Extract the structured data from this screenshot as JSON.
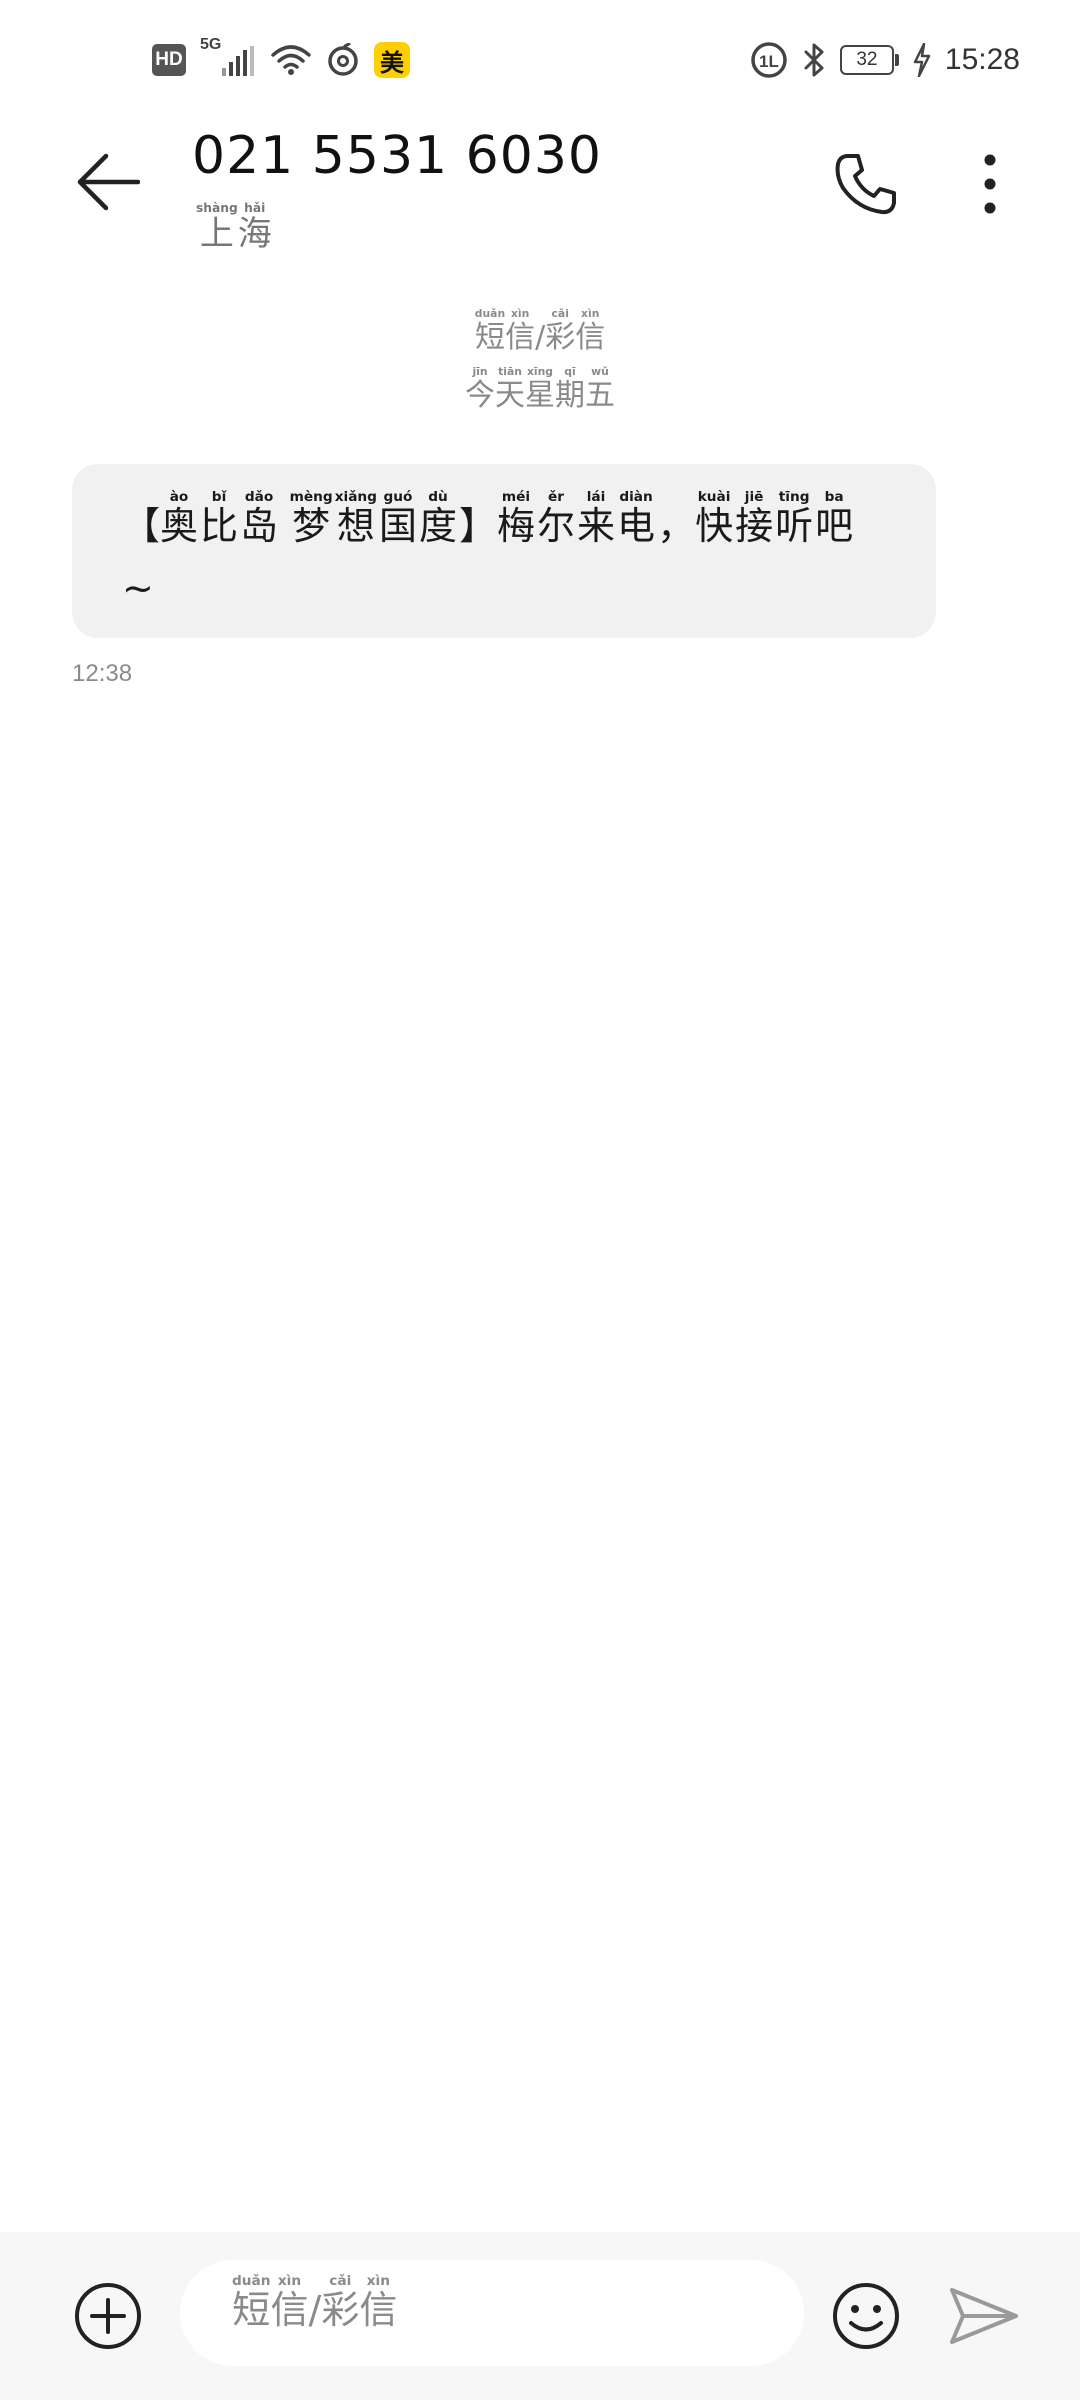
{
  "status_bar": {
    "hd_label": "HD",
    "network_label": "5G",
    "meituan_badge": "美",
    "battery_level": "32",
    "time": "15:28",
    "icons": [
      "hd-icon",
      "signal-icon",
      "wifi-icon",
      "netease-music-icon",
      "meituan-icon",
      "volte-icon",
      "bluetooth-icon",
      "battery-icon",
      "charging-icon"
    ]
  },
  "header": {
    "phone_number": "021 5531 6030",
    "location": [
      {
        "char": "上",
        "py": "shàng"
      },
      {
        "char": "海",
        "py": "hǎi"
      }
    ],
    "icons": [
      "back-arrow-icon",
      "phone-icon",
      "more-vertical-icon"
    ]
  },
  "conversation": {
    "type_label": [
      {
        "char": "短",
        "py": "duǎn"
      },
      {
        "char": "信",
        "py": "xìn"
      },
      {
        "char": "/",
        "py": ""
      },
      {
        "char": "彩",
        "py": "cǎi"
      },
      {
        "char": "信",
        "py": "xìn"
      }
    ],
    "date_label": [
      {
        "char": "今",
        "py": "jīn"
      },
      {
        "char": "天",
        "py": "tiān"
      },
      {
        "char": "星",
        "py": "xīng"
      },
      {
        "char": "期",
        "py": "qī"
      },
      {
        "char": "五",
        "py": "wǔ"
      }
    ]
  },
  "messages": [
    {
      "text": [
        {
          "char": "【",
          "py": ""
        },
        {
          "char": "奥",
          "py": "ào"
        },
        {
          "char": "比",
          "py": "bǐ"
        },
        {
          "char": "岛",
          "py": "dǎo"
        },
        {
          "char": " ",
          "py": ""
        },
        {
          "char": "梦",
          "py": "mèng"
        },
        {
          "char": "想",
          "py": "xiǎng"
        },
        {
          "char": "国",
          "py": "guó"
        },
        {
          "char": "度",
          "py": "dù"
        },
        {
          "char": "】",
          "py": ""
        },
        {
          "char": "梅",
          "py": "méi"
        },
        {
          "char": "尔",
          "py": "ěr"
        },
        {
          "char": "来",
          "py": "lái"
        },
        {
          "char": "电",
          "py": "diàn"
        },
        {
          "char": "，",
          "py": ""
        },
        {
          "char": "快",
          "py": "kuài"
        },
        {
          "char": "接",
          "py": "jiē"
        },
        {
          "char": "听",
          "py": "tīng"
        },
        {
          "char": "吧",
          "py": "ba"
        },
        {
          "char": "~",
          "py": ""
        }
      ],
      "time": "12:38"
    }
  ],
  "compose": {
    "placeholder": [
      {
        "char": "短",
        "py": "duǎn"
      },
      {
        "char": "信",
        "py": "xìn"
      },
      {
        "char": "/",
        "py": ""
      },
      {
        "char": "彩",
        "py": "cǎi"
      },
      {
        "char": "信",
        "py": "xìn"
      }
    ],
    "icons": [
      "add-circle-icon",
      "emoji-icon",
      "send-icon"
    ]
  },
  "colors": {
    "bubble_bg": "#f1f1f1",
    "compose_bg": "#f7f7f7",
    "secondary_text": "#8a8a8a",
    "meituan_yellow": "#ffd000"
  }
}
